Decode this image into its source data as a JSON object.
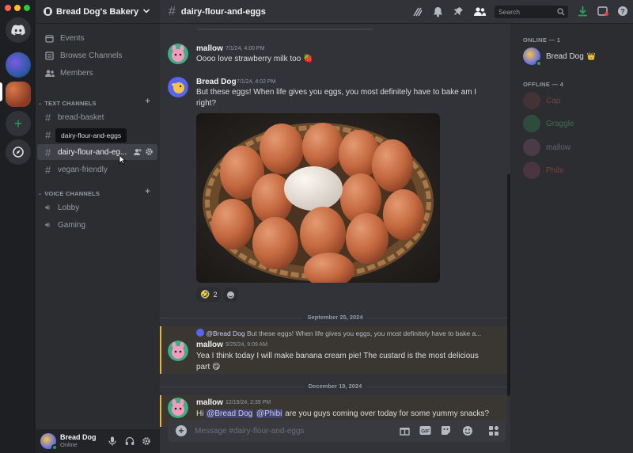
{
  "server": {
    "name": "Bread Dog's Bakery"
  },
  "nav": [
    {
      "label": "Events",
      "icon": "calendar-icon"
    },
    {
      "label": "Browse Channels",
      "icon": "browse-channels-icon"
    },
    {
      "label": "Members",
      "icon": "members-icon"
    }
  ],
  "text_category": "TEXT CHANNELS",
  "text_channels": [
    "bread-basket",
    "",
    "dairy-flour-and-eg...",
    "vegan-friendly"
  ],
  "tooltip": "dairy-flour-and-eggs",
  "voice_category": "VOICE CHANNELS",
  "voice_channels": [
    "Lobby",
    "Gaming"
  ],
  "current_user": {
    "name": "Bread Dog",
    "status": "Online"
  },
  "topbar": {
    "channel": "dairy-flour-and-eggs",
    "search_placeholder": "Search"
  },
  "messages": [
    {
      "author": "mallow",
      "time": "7/1/24, 4:00 PM",
      "text": "Oooo love strawberry milk too",
      "emoji": "🍓"
    },
    {
      "author": "Bread Dog",
      "time": "7/1/24, 4:02 PM",
      "text_line1": "But these eggs! When life gives you eggs, you most definitely have to bake am I",
      "text_line2": "right?",
      "reaction_count": "2"
    },
    {
      "author": "mallow",
      "time": "9/25/24, 9:09 AM",
      "reply_author": "@Bread Dog",
      "reply_text": "But these eggs! When life gives you eggs, you most definitely have to bake a...",
      "text_line1": "Yea I think today I will make banana cream pie! The custard is the most delicious",
      "text_line2": "part",
      "emoji": "😋"
    },
    {
      "author": "mallow",
      "time": "12/19/24, 2:39 PM",
      "text_prefix": "Hi",
      "mention1": "@Bread Dog",
      "mention2": "@Phibi",
      "text_suffix": "are you guys coming over today for some yummy snacks?"
    }
  ],
  "dates": [
    "September 25, 2024",
    "December 19, 2024"
  ],
  "composer": {
    "placeholder": "Message #dairy-flour-and-eggs"
  },
  "members": {
    "online_header": "ONLINE — 1",
    "online": [
      {
        "name": "Bread Dog",
        "badge": "👑",
        "color": "#dbdee1"
      }
    ],
    "offline_header": "OFFLINE — 4",
    "offline": [
      {
        "name": "Cap",
        "color": "#9a4a4a"
      },
      {
        "name": "Graggle",
        "color": "#4f8a5b"
      },
      {
        "name": "mallow",
        "color": "#6f7178"
      },
      {
        "name": "Phibi",
        "color": "#9a4a4a"
      }
    ]
  },
  "colors": {
    "accent": "#5865f2",
    "online": "#23a55a",
    "highlight": "#f0b232",
    "download": "#23a55a"
  }
}
